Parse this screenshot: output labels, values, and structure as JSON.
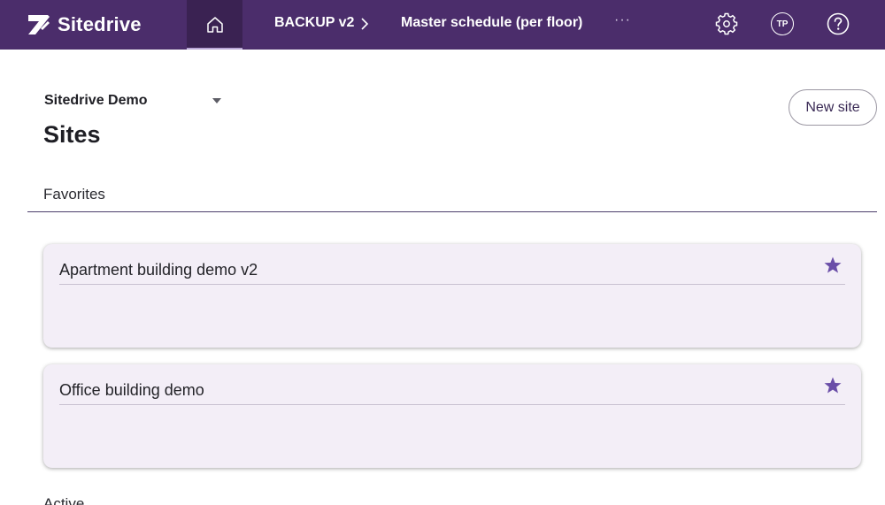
{
  "header": {
    "logo_text": "Sitedrive",
    "breadcrumb": {
      "project": "BACKUP v2",
      "schedule": "Master schedule (per floor)",
      "more": "···"
    },
    "avatar_initials": "TP",
    "icons": [
      "home-icon",
      "chevron-right-icon",
      "gear-icon",
      "help-icon"
    ]
  },
  "main": {
    "org_selector": "Sitedrive Demo",
    "title": "Sites",
    "new_site_label": "New site",
    "favorites_label": "Favorites",
    "favorites": [
      {
        "name": "Apartment building demo v2",
        "starred": true
      },
      {
        "name": "Office building demo",
        "starred": true
      }
    ],
    "active_label": "Active"
  },
  "colors": {
    "topbar": "#4b2d6b",
    "active_tab": "#3a2252",
    "card_bg": "#f3eef7",
    "star": "#6a4ea8"
  }
}
